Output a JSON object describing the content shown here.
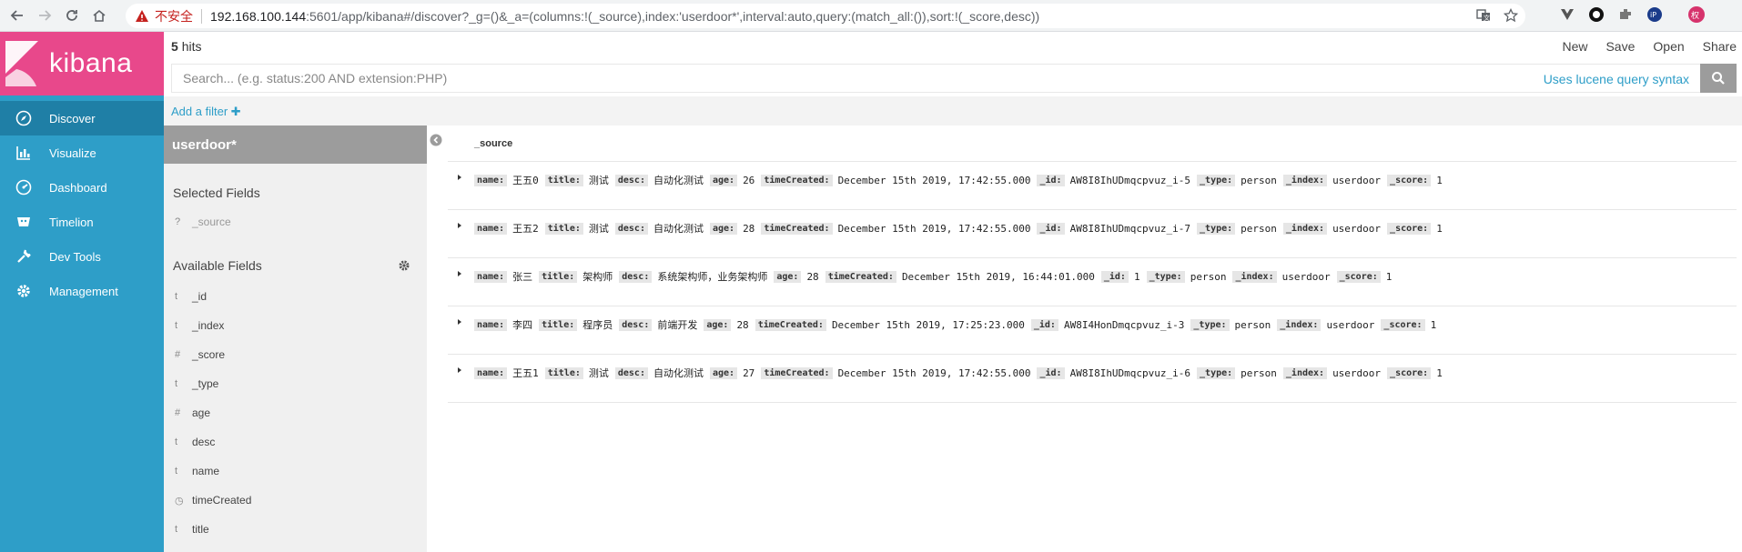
{
  "browser": {
    "insecure_label": "不安全",
    "url_host": "192.168.100.144",
    "url_rest": ":5601/app/kibana#/discover?_g=()&_a=(columns:!(_source),index:'userdoor*',interval:auto,query:(match_all:()),sort:!(_score,desc))",
    "profile_initial": "权"
  },
  "sidebar": {
    "brand": "kibana",
    "items": [
      {
        "label": "Discover",
        "icon": "compass-icon"
      },
      {
        "label": "Visualize",
        "icon": "bar-chart-icon"
      },
      {
        "label": "Dashboard",
        "icon": "gauge-icon"
      },
      {
        "label": "Timelion",
        "icon": "timelion-icon"
      },
      {
        "label": "Dev Tools",
        "icon": "wrench-icon"
      },
      {
        "label": "Management",
        "icon": "gear-icon"
      }
    ]
  },
  "topbar": {
    "hits_count": "5",
    "hits_label": "hits",
    "actions": [
      "New",
      "Save",
      "Open",
      "Share"
    ]
  },
  "search": {
    "placeholder": "Search... (e.g. status:200 AND extension:PHP)",
    "syntax_link": "Uses lucene query syntax"
  },
  "filter": {
    "add_label": "Add a filter"
  },
  "fields": {
    "index_pattern": "userdoor*",
    "selected_title": "Selected Fields",
    "selected": [
      {
        "type": "?",
        "name": "_source"
      }
    ],
    "available_title": "Available Fields",
    "available": [
      {
        "type": "t",
        "name": "_id"
      },
      {
        "type": "t",
        "name": "_index"
      },
      {
        "type": "#",
        "name": "_score"
      },
      {
        "type": "t",
        "name": "_type"
      },
      {
        "type": "#",
        "name": "age"
      },
      {
        "type": "t",
        "name": "desc"
      },
      {
        "type": "t",
        "name": "name"
      },
      {
        "type": "◷",
        "name": "timeCreated"
      },
      {
        "type": "t",
        "name": "title"
      }
    ]
  },
  "table": {
    "column_header": "_source",
    "rows": [
      [
        [
          "name:",
          "王五0"
        ],
        [
          "title:",
          "测试"
        ],
        [
          "desc:",
          "自动化测试"
        ],
        [
          "age:",
          "26"
        ],
        [
          "timeCreated:",
          "December 15th 2019, 17:42:55.000"
        ],
        [
          "_id:",
          "AW8I8IhUDmqcpvuz_i-5"
        ],
        [
          "_type:",
          "person"
        ],
        [
          "_index:",
          "userdoor"
        ],
        [
          "_score:",
          "1"
        ]
      ],
      [
        [
          "name:",
          "王五2"
        ],
        [
          "title:",
          "测试"
        ],
        [
          "desc:",
          "自动化测试"
        ],
        [
          "age:",
          "28"
        ],
        [
          "timeCreated:",
          "December 15th 2019, 17:42:55.000"
        ],
        [
          "_id:",
          "AW8I8IhUDmqcpvuz_i-7"
        ],
        [
          "_type:",
          "person"
        ],
        [
          "_index:",
          "userdoor"
        ],
        [
          "_score:",
          "1"
        ]
      ],
      [
        [
          "name:",
          "张三"
        ],
        [
          "title:",
          "架构师"
        ],
        [
          "desc:",
          "系统架构师，业务架构师"
        ],
        [
          "age:",
          "28"
        ],
        [
          "timeCreated:",
          "December 15th 2019, 16:44:01.000"
        ],
        [
          "_id:",
          "1"
        ],
        [
          "_type:",
          "person"
        ],
        [
          "_index:",
          "userdoor"
        ],
        [
          "_score:",
          "1"
        ]
      ],
      [
        [
          "name:",
          "李四"
        ],
        [
          "title:",
          "程序员"
        ],
        [
          "desc:",
          "前端开发"
        ],
        [
          "age:",
          "28"
        ],
        [
          "timeCreated:",
          "December 15th 2019, 17:25:23.000"
        ],
        [
          "_id:",
          "AW8I4HonDmqcpvuz_i-3"
        ],
        [
          "_type:",
          "person"
        ],
        [
          "_index:",
          "userdoor"
        ],
        [
          "_score:",
          "1"
        ]
      ],
      [
        [
          "name:",
          "王五1"
        ],
        [
          "title:",
          "测试"
        ],
        [
          "desc:",
          "自动化测试"
        ],
        [
          "age:",
          "27"
        ],
        [
          "timeCreated:",
          "December 15th 2019, 17:42:55.000"
        ],
        [
          "_id:",
          "AW8I8IhUDmqcpvuz_i-6"
        ],
        [
          "_type:",
          "person"
        ],
        [
          "_index:",
          "userdoor"
        ],
        [
          "_score:",
          "1"
        ]
      ]
    ]
  },
  "colors": {
    "kibana_pink": "#e8488b",
    "sidebar_blue": "#2e9ec8",
    "link_blue": "#2e9ec8"
  }
}
